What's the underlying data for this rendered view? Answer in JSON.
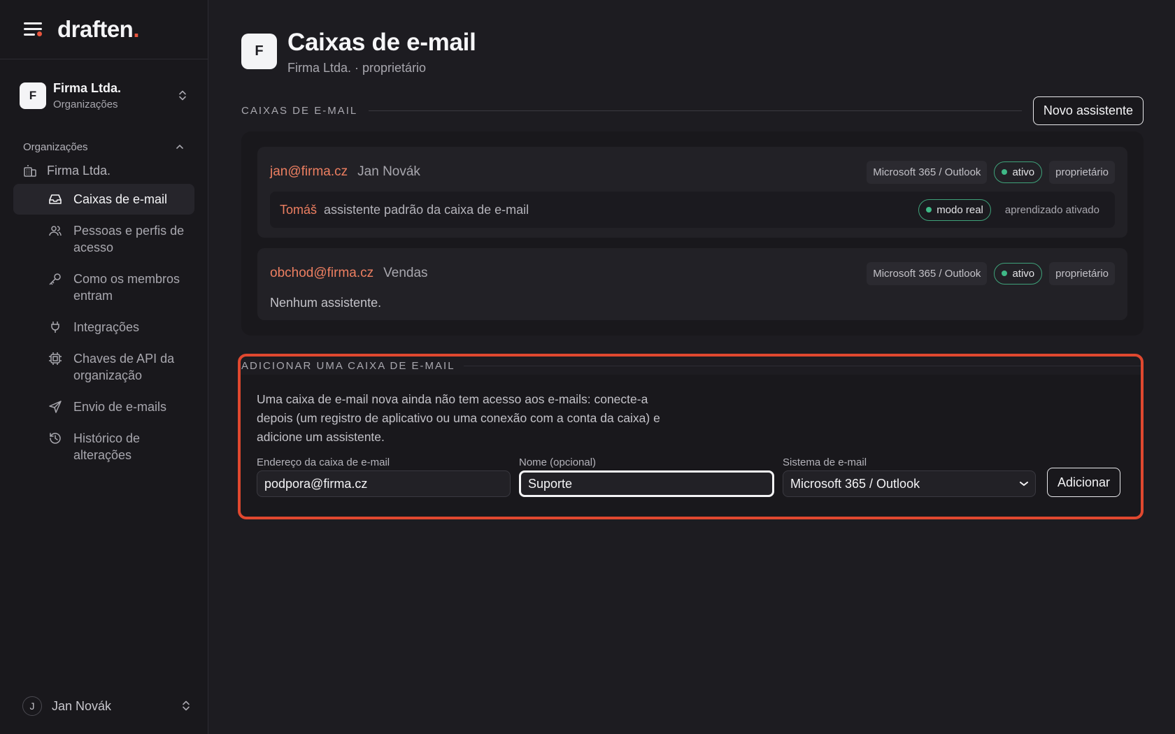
{
  "brand": {
    "name": "draften",
    "dot": "."
  },
  "org_switcher": {
    "avatar": "F",
    "name": "Firma Ltda.",
    "subtitle": "Organizações"
  },
  "sidebar": {
    "section_title": "Organizações",
    "org_name": "Firma Ltda.",
    "items": [
      {
        "label": "Caixas de e-mail",
        "icon": "inbox-icon",
        "active": true
      },
      {
        "label": "Pessoas e perfis de acesso",
        "icon": "users-icon"
      },
      {
        "label": "Como os membros entram",
        "icon": "key-icon"
      },
      {
        "label": "Integrações",
        "icon": "plug-icon"
      },
      {
        "label": "Chaves de API da organização",
        "icon": "chip-icon"
      },
      {
        "label": "Envio de e-mails",
        "icon": "send-icon"
      },
      {
        "label": "Histórico de alterações",
        "icon": "history-icon"
      }
    ]
  },
  "user": {
    "avatar": "J",
    "name": "Jan Novák"
  },
  "page": {
    "avatar": "F",
    "title": "Caixas de e-mail",
    "subtitle": "Firma Ltda. · proprietário"
  },
  "mailboxes_section": {
    "title": "CAIXAS DE E-MAIL",
    "new_button": "Novo assistente"
  },
  "mailboxes": [
    {
      "email": "jan@firma.cz",
      "owner": "Jan Novák",
      "system": "Microsoft 365 / Outlook",
      "status": "ativo",
      "role": "proprietário",
      "assistant": {
        "name": "Tomáš",
        "desc": "assistente padrão da caixa de e-mail",
        "mode": "modo real",
        "learning": "aprendizado ativado"
      }
    },
    {
      "email": "obchod@firma.cz",
      "owner": "Vendas",
      "system": "Microsoft 365 / Outlook",
      "status": "ativo",
      "role": "proprietário",
      "no_assistant": "Nenhum assistente."
    }
  ],
  "add_section": {
    "title": "ADICIONAR UMA CAIXA DE E-MAIL",
    "help": "Uma caixa de e-mail nova ainda não tem acesso aos e-mails: conecte-a depois (um registro de aplicativo ou uma conexão com a conta da caixa) e adicione um assistente.",
    "address_label": "Endereço da caixa de e-mail",
    "address_value": "podpora@firma.cz",
    "name_label": "Nome (opcional)",
    "name_value": "Suporte",
    "system_label": "Sistema de e-mail",
    "system_value": "Microsoft 365 / Outlook",
    "add_button": "Adicionar"
  },
  "colors": {
    "accent": "#e8553e",
    "email": "#ed7f61",
    "status": "#3fb987",
    "highlight": "#e0482f"
  }
}
